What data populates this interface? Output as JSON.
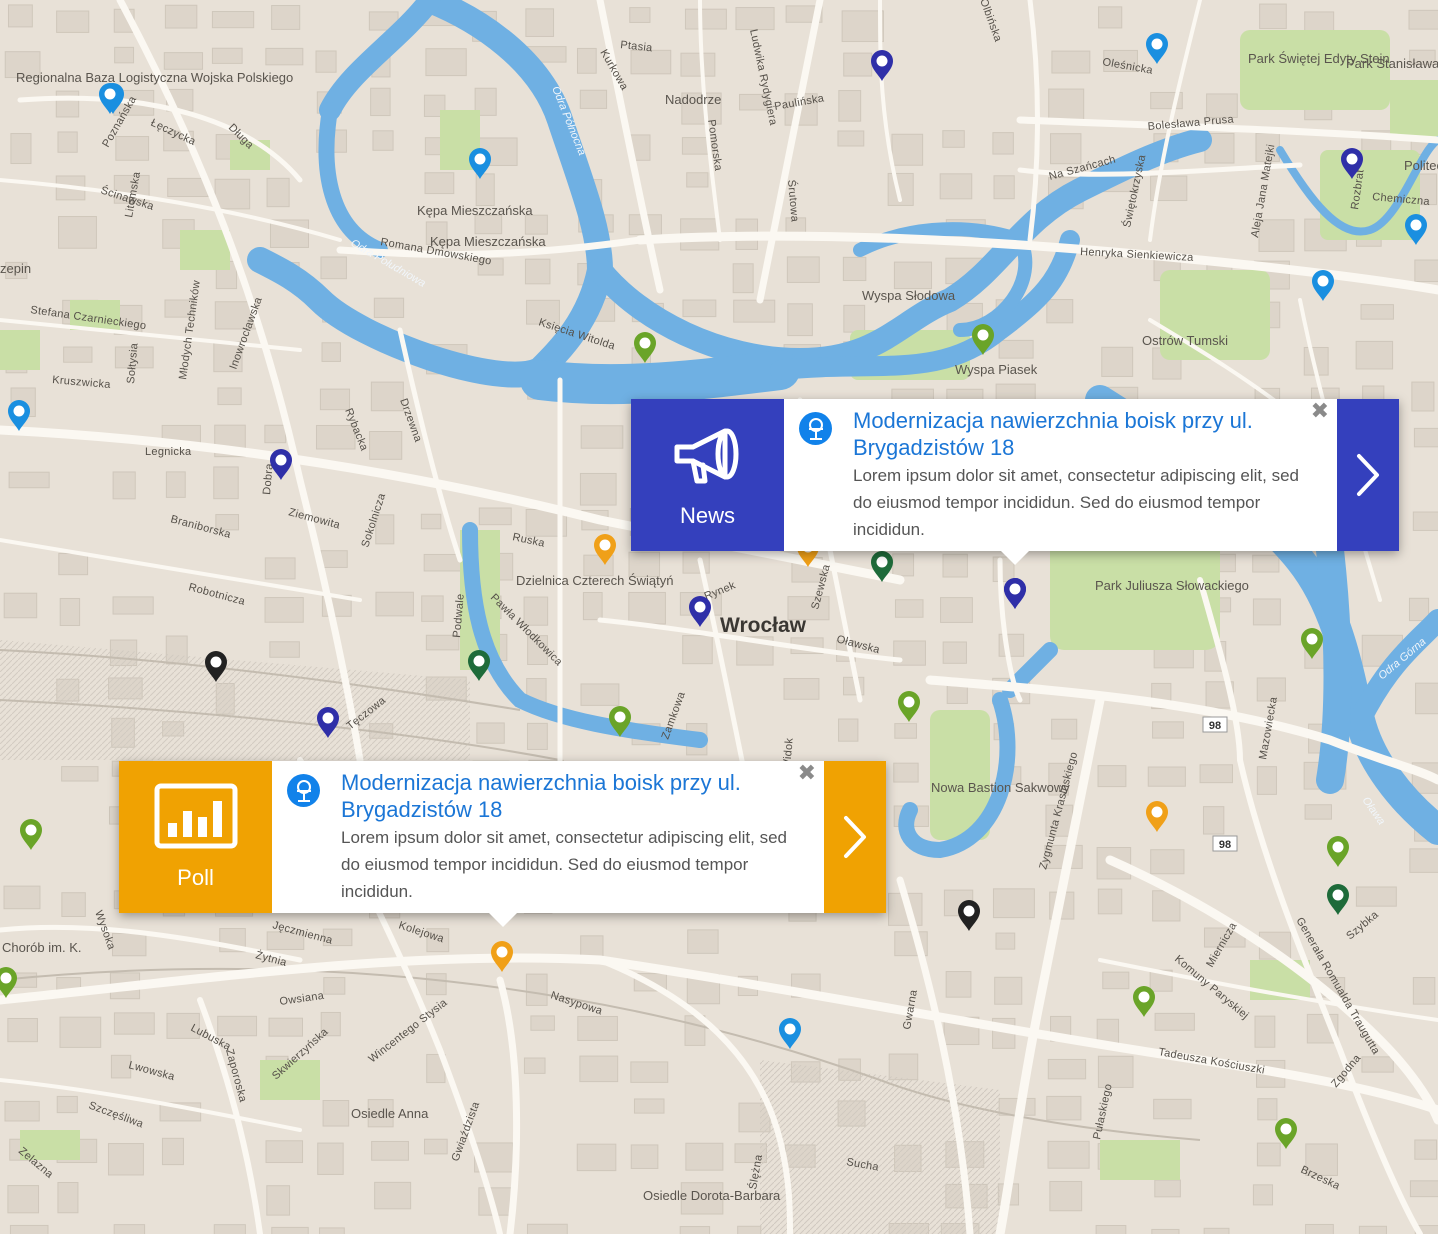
{
  "map": {
    "city_label": "Wrocław",
    "place_labels": [
      "Nadodrze",
      "Kępa Mieszczańska",
      "Kępa Mieszczańska",
      "Wyspa Słodowa",
      "Wyspa Piasek",
      "Ostrów Tumski",
      "Dzielnica Czterech Świątyń",
      "Park Juliusza Słowackiego",
      "Osiedle Anna",
      "Osiedle Dorota-Barbara",
      "Regionalna Baza Logistyczna Wojska Polskiego",
      "Park Świętej Edyty Stein",
      "Park Stanisława Tołpy",
      "Nowa Bastion Sakwowy",
      "Politechnika Wrocławska",
      "Chorób im. K.",
      "zepin"
    ],
    "street_labels": [
      "Poznańska",
      "Łęczycka",
      "Długa",
      "Litomska",
      "Ścinawska",
      "Stefana Czarnieckiego",
      "Młodych Techników",
      "Inowrocławska",
      "Sołtysia",
      "Kruszwicka",
      "Legnicka",
      "Dobra",
      "Ziemowita",
      "Braniborska",
      "Robotnicza",
      "Rybacka",
      "Drzewna",
      "Sokolnicza",
      "Ruska",
      "Podwale",
      "Pawła Włodkowica",
      "Księcia Witolda",
      "Romana Dmowskiego",
      "Ptasia",
      "Kurkowa",
      "Ludwika Rydygiera",
      "Paulińska",
      "Pomorska",
      "Śrutowa",
      "Olbińska",
      "Oleśnicka",
      "Bolesława Prusa",
      "Na Szańcach",
      "Świętokrzyska",
      "Aleja Jana Matejki",
      "Rozbrat",
      "Chemiczna",
      "Henryka Sienkiewicza",
      "Rynek",
      "Szewska",
      "Oławska",
      "Zamkowa",
      "Widok",
      "Zygmunta Krasińskiego",
      "Mazowiecka",
      "Komuny Paryskiej",
      "Mierniczа",
      "Generała Romualda Traugutta",
      "Tadeusza Kościuszki",
      "Pułaskiego",
      "Gwarna",
      "Sucha",
      "Ślężna",
      "Gwiaździsta",
      "Nasypowa",
      "Wincentego Stysia",
      "Skwierzyńska",
      "Owsiana",
      "Żytnia",
      "Jęczmienna",
      "Kolejowa",
      "Lubuska",
      "Zaporoska",
      "Lwowska",
      "Szczęśliwa",
      "Zelazna",
      "Wysoka",
      "Tęczowa",
      "Brzeska",
      "Szybka",
      "Zgodna"
    ],
    "water_labels": [
      "Odra Północna",
      "Odra Południowa",
      "Odra Górna",
      "Oława"
    ],
    "route_numbers": [
      "98",
      "98"
    ]
  },
  "markers": [
    {
      "color": "#1a8fe0"
    },
    {
      "color": "#1a8fe0"
    },
    {
      "color": "#1a8fe0"
    },
    {
      "color": "#1a8fe0"
    },
    {
      "color": "#1a8fe0"
    },
    {
      "color": "#1a8fe0"
    },
    {
      "color": "#1a8fe0"
    },
    {
      "color": "#1a8fe0"
    },
    {
      "color": "#2f2fa8"
    },
    {
      "color": "#2f2fa8"
    },
    {
      "color": "#2f2fa8"
    },
    {
      "color": "#2f2fa8"
    },
    {
      "color": "#2f2fa8"
    },
    {
      "color": "#2f2fa8"
    },
    {
      "color": "#2f2fa8"
    },
    {
      "color": "#6aa428"
    },
    {
      "color": "#6aa428"
    },
    {
      "color": "#6aa428"
    },
    {
      "color": "#6aa428"
    },
    {
      "color": "#6aa428"
    },
    {
      "color": "#6aa428"
    },
    {
      "color": "#6aa428"
    },
    {
      "color": "#6aa428"
    },
    {
      "color": "#6aa428"
    },
    {
      "color": "#6aa428"
    },
    {
      "color": "#1e6b3a"
    },
    {
      "color": "#1e6b3a"
    },
    {
      "color": "#1e6b3a"
    },
    {
      "color": "#f0a018"
    },
    {
      "color": "#f0a018"
    },
    {
      "color": "#f0a018"
    },
    {
      "color": "#f0a018"
    },
    {
      "color": "#222222"
    },
    {
      "color": "#222222"
    }
  ],
  "popups": {
    "news": {
      "type_label": "News",
      "type_icon": "megaphone-icon",
      "accent": "#3440bd",
      "title": "Modernizacja nawierzchnia boisk przy ul. Brygadzistów 18",
      "description": "Lorem ipsum dolor sit amet, consectetur adipiscing elit, sed do eiusmod tempor incididun. Sed do eiusmod tempor incididun.",
      "close_icon": "✖",
      "author_icon": "worker-icon"
    },
    "poll": {
      "type_label": "Poll",
      "type_icon": "bar-chart-icon",
      "accent": "#f0a202",
      "title": "Modernizacja nawierzchnia boisk przy ul. Brygadzistów 18",
      "description": "Lorem ipsum dolor sit amet, consectetur adipiscing elit, sed do eiusmod tempor incididun. Sed do eiusmod tempor incididun.",
      "close_icon": "✖",
      "author_icon": "worker-icon"
    }
  }
}
